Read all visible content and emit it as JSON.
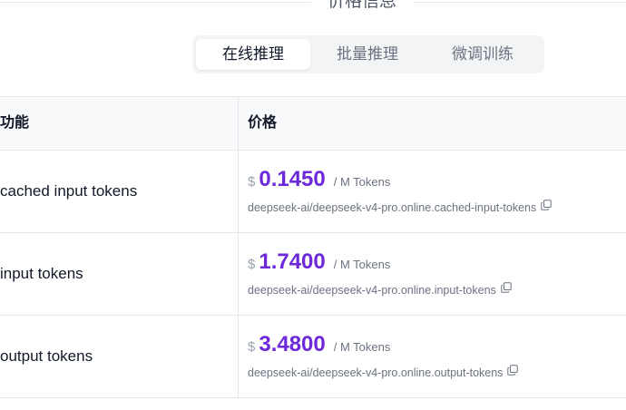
{
  "section": {
    "title": "价格信息"
  },
  "tabs": [
    {
      "label": "在线推理",
      "active": true
    },
    {
      "label": "批量推理",
      "active": false
    },
    {
      "label": "微调训练",
      "active": false
    }
  ],
  "table": {
    "headers": {
      "feature": "功能",
      "price": "价格"
    },
    "rows": [
      {
        "feature": "cached input tokens",
        "currency": "$",
        "amount": "0.1450",
        "unit": "/ M Tokens",
        "model_id": "deepseek-ai/deepseek-v4-pro.online.cached-input-tokens"
      },
      {
        "feature": "input tokens",
        "currency": "$",
        "amount": "1.7400",
        "unit": "/ M Tokens",
        "model_id": "deepseek-ai/deepseek-v4-pro.online.input-tokens"
      },
      {
        "feature": "output tokens",
        "currency": "$",
        "amount": "3.4800",
        "unit": "/ M Tokens",
        "model_id": "deepseek-ai/deepseek-v4-pro.online.output-tokens"
      }
    ]
  },
  "colors": {
    "accent": "#6d28d9",
    "muted": "#6b7280",
    "border": "#e5e7eb"
  },
  "icons": {
    "copy": "copy-icon"
  }
}
